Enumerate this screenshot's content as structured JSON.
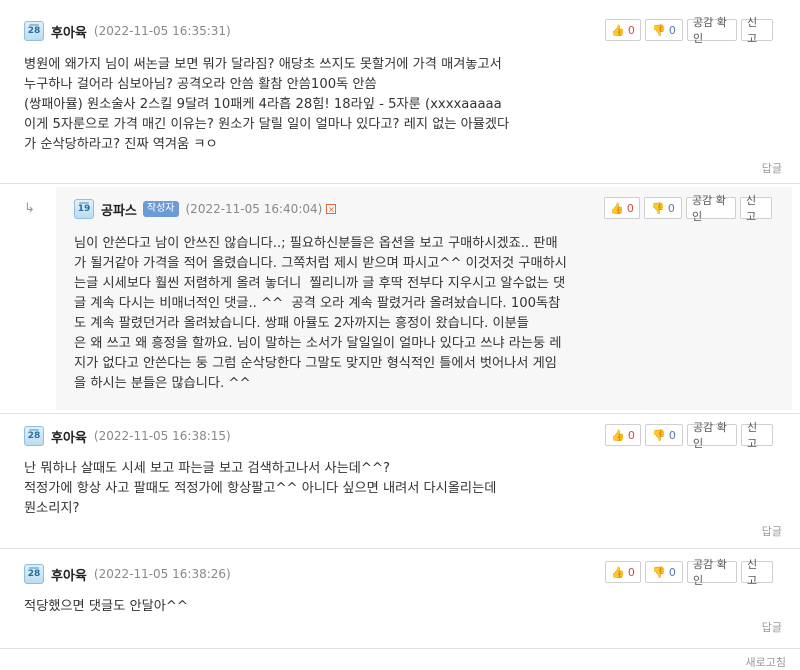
{
  "comments": [
    {
      "level": "28",
      "author": "후아육",
      "date": "(2022-11-05 16:35:31)",
      "like_count": "0",
      "dislike_count": "0",
      "gong_label": "공감 확인",
      "report_label": "신고",
      "text": "병원에 왜가지 님이 써논글 보면 뭐가 달라짐? 애당초 쓰지도 못할거에 가격 매겨놓고서\n누구하나 걸어라 심보아님? 공격오라 안씀 활참 안씀100독 안씀\n(쌍패아뮬) 원소술사 2스킬 9달려 10패케 4라흡 28힘! 18라잎 - 5자룬 (xxxxaaaaa\n이게 5자룬으로 가격 매긴 이유는? 원소가 달릴 일이 얼마나 있다고? 레지 없는 아뮬겠다\n가 순삭당하라고? 진짜 역겨움 ㅋㅇ",
      "reply_label": "답글"
    },
    {
      "level": "19",
      "author": "공파스",
      "badge": "작성자",
      "date": "(2022-11-05 16:40:04)",
      "like_count": "0",
      "dislike_count": "0",
      "gong_label": "공감 확인",
      "report_label": "신고",
      "text": "님이 안쓴다고 남이 안쓰진 않습니다..; 필요하신분들은 옵션을 보고 구매하시겠죠.. 판매\n가 될거같아 가격을 적어 올렸습니다. 그쪽처럼 제시 받으며 파시고^^ 이것저것 구매하시\n는글 시세보다 훨씬 저렴하게 올려 놓더니  찔리니까 글 후딱 전부다 지우시고 알수없는 댓\n글 계속 다시는 비매너적인 댓글.. ^^  공격 오라 계속 팔렸거라 올려놨습니다. 100독참\n도 계속 팔렸던거라 올려놨습니다. 쌍패 아뮬도 2자까지는 흥정이 왔습니다. 이분들\n은 왜 쓰고 왜 흥정을 할까요. 님이 말하는 소서가 달일일이 얼마나 있다고 쓰냐 라는둥 레\n지가 없다고 안쓴다는 둥 그럼 순삭당한다 그말도 맞지만 형식적인 틀에서 벗어나서 게임\n을 하시는 분들은 많습니다. ^^"
    },
    {
      "level": "28",
      "author": "후아육",
      "date": "(2022-11-05 16:38:15)",
      "like_count": "0",
      "dislike_count": "0",
      "gong_label": "공감 확인",
      "report_label": "신고",
      "text": "난 뭐하나 살때도 시세 보고 파는글 보고 검색하고나서 사는데^^?\n적정가에 항상 사고 팔때도 적정가에 항상팔고^^ 아니다 싶으면 내려서 다시올리는데\n뭔소리지?",
      "reply_label": "답글"
    },
    {
      "level": "28",
      "author": "후아육",
      "date": "(2022-11-05 16:38:26)",
      "like_count": "0",
      "dislike_count": "0",
      "gong_label": "공감 확인",
      "report_label": "신고",
      "text": "적당했으면 댓글도 안달아^^",
      "reply_label": "답글"
    }
  ],
  "bottom_partial": "새로고침",
  "icons": {
    "like": "thumbs-up-icon",
    "dislike": "thumbs-down-icon",
    "reply_arrow": "reply-arrow-icon",
    "flag": "flag-icon"
  },
  "colors": {
    "like": "#d04a4a",
    "dislike": "#5b76b8",
    "badge": "#6b9bd6",
    "reply_bg": "#f7f7f7"
  }
}
